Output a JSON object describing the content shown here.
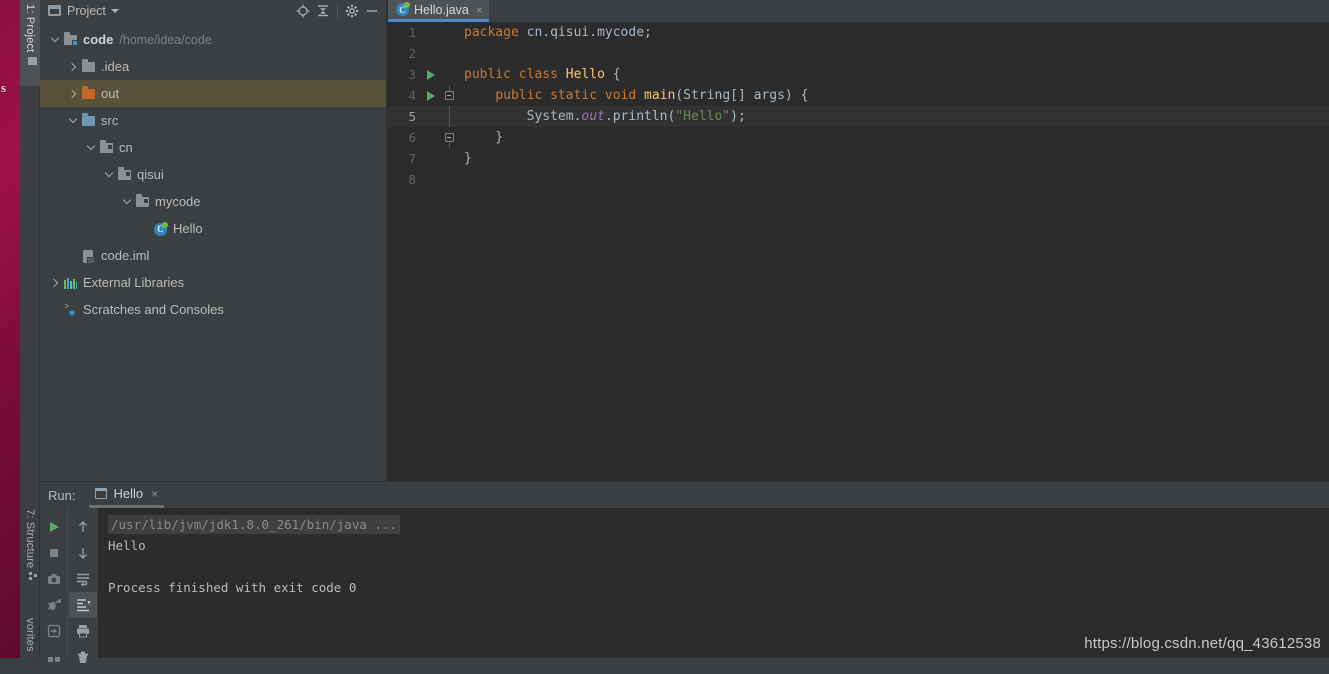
{
  "wallpaper": {
    "glyph": "s"
  },
  "left_stripe": {
    "tabs": [
      {
        "name": "project",
        "label": "1: Project",
        "icon": "folder-icon",
        "active": true
      },
      {
        "name": "structure",
        "label": "7: Structure",
        "icon": "structure-icon",
        "active": false
      },
      {
        "name": "favorites",
        "label": "vorites",
        "icon": "",
        "active": false
      }
    ]
  },
  "project_panel": {
    "title": "Project",
    "header_icons": [
      {
        "name": "locate-icon",
        "tooltip": "Select Opened File"
      },
      {
        "name": "collapse-all-icon",
        "tooltip": "Collapse All"
      },
      {
        "name": "gear-icon",
        "tooltip": "Settings"
      },
      {
        "name": "minimize-icon",
        "tooltip": "Hide"
      }
    ],
    "tree": [
      {
        "label": "code",
        "path": "/home/idea/code",
        "icon": "module-folder-icon",
        "arrow": "down",
        "indent": 0,
        "bold": true,
        "selected": false
      },
      {
        "label": ".idea",
        "path": "",
        "icon": "folder-gray-icon",
        "arrow": "right",
        "indent": 1,
        "bold": false,
        "selected": false
      },
      {
        "label": "out",
        "path": "",
        "icon": "folder-excluded-icon",
        "arrow": "right",
        "indent": 1,
        "bold": false,
        "selected": true
      },
      {
        "label": "src",
        "path": "",
        "icon": "folder-source-icon",
        "arrow": "down",
        "indent": 1,
        "bold": false,
        "selected": false
      },
      {
        "label": "cn",
        "path": "",
        "icon": "package-icon",
        "arrow": "down",
        "indent": 2,
        "bold": false,
        "selected": false
      },
      {
        "label": "qisui",
        "path": "",
        "icon": "package-icon",
        "arrow": "down",
        "indent": 3,
        "bold": false,
        "selected": false
      },
      {
        "label": "mycode",
        "path": "",
        "icon": "package-icon",
        "arrow": "down",
        "indent": 4,
        "bold": false,
        "selected": false
      },
      {
        "label": "Hello",
        "path": "",
        "icon": "java-class-icon",
        "arrow": "none",
        "indent": 5,
        "bold": false,
        "selected": false
      },
      {
        "label": "code.iml",
        "path": "",
        "icon": "iml-file-icon",
        "arrow": "none",
        "indent": 1,
        "bold": false,
        "selected": false
      },
      {
        "label": "External Libraries",
        "path": "",
        "icon": "libraries-icon",
        "arrow": "right",
        "indent": 0,
        "bold": false,
        "selected": false
      },
      {
        "label": "Scratches and Consoles",
        "path": "",
        "icon": "scratches-icon",
        "arrow": "none",
        "indent": 0,
        "bold": false,
        "selected": false
      }
    ]
  },
  "editor": {
    "tabs": [
      {
        "label": "Hello.java",
        "icon": "java-class-icon",
        "close": "×",
        "active": true
      }
    ],
    "current_line": 5,
    "lines": [
      {
        "n": "1",
        "run": false,
        "fold": "none",
        "tokens": [
          {
            "t": "package ",
            "c": "k"
          },
          {
            "t": "cn.qisui.mycode",
            "c": "p"
          },
          {
            "t": ";",
            "c": "sc"
          }
        ],
        "indent": 0
      },
      {
        "n": "2",
        "run": false,
        "fold": "none",
        "tokens": [],
        "indent": 0
      },
      {
        "n": "3",
        "run": true,
        "fold": "none",
        "tokens": [
          {
            "t": "public ",
            "c": "k"
          },
          {
            "t": "class ",
            "c": "k"
          },
          {
            "t": "Hello",
            "c": "m"
          },
          {
            "t": " {",
            "c": "p"
          }
        ],
        "indent": 0
      },
      {
        "n": "4",
        "run": true,
        "fold": "start",
        "tokens": [
          {
            "t": "    ",
            "c": "p"
          },
          {
            "t": "public ",
            "c": "k"
          },
          {
            "t": "static ",
            "c": "k"
          },
          {
            "t": "void ",
            "c": "k"
          },
          {
            "t": "main",
            "c": "m"
          },
          {
            "t": "(String[] args) {",
            "c": "p"
          }
        ],
        "indent": 1
      },
      {
        "n": "5",
        "run": false,
        "fold": "line",
        "tokens": [
          {
            "t": "        System.",
            "c": "p"
          },
          {
            "t": "out",
            "c": "f"
          },
          {
            "t": ".println(",
            "c": "p"
          },
          {
            "t": "\"Hello\"",
            "c": "s"
          },
          {
            "t": ");",
            "c": "sc"
          }
        ],
        "indent": 2
      },
      {
        "n": "6",
        "run": false,
        "fold": "end",
        "tokens": [
          {
            "t": "    }",
            "c": "p"
          }
        ],
        "indent": 1
      },
      {
        "n": "7",
        "run": false,
        "fold": "none",
        "tokens": [
          {
            "t": "}",
            "c": "p"
          }
        ],
        "indent": 0
      },
      {
        "n": "8",
        "run": false,
        "fold": "none",
        "tokens": [],
        "indent": 0
      }
    ]
  },
  "run_panel": {
    "label": "Run:",
    "tab_label": "Hello",
    "tab_close": "×",
    "toolbar_left": [
      {
        "name": "rerun-button",
        "icon": "play-icon",
        "active": false
      },
      {
        "name": "stop-button",
        "icon": "stop-icon",
        "active": false
      },
      {
        "name": "dump-threads-button",
        "icon": "camera-icon",
        "active": false
      },
      {
        "name": "restore-layout-button",
        "icon": "bug-arrow-icon",
        "active": false
      },
      {
        "name": "attach-button",
        "icon": "login-icon",
        "active": false
      },
      {
        "name": "layout-button",
        "icon": "layout-icon",
        "active": false
      }
    ],
    "toolbar_right": [
      {
        "name": "up-stack-button",
        "icon": "arrow-up-icon",
        "active": false
      },
      {
        "name": "down-stack-button",
        "icon": "arrow-down-icon",
        "active": false
      },
      {
        "name": "soft-wrap-button",
        "icon": "soft-wrap-icon",
        "active": false
      },
      {
        "name": "scroll-to-end-button",
        "icon": "scroll-end-icon",
        "active": true
      },
      {
        "name": "print-button",
        "icon": "printer-icon",
        "active": false
      },
      {
        "name": "clear-all-button",
        "icon": "trash-icon",
        "active": false
      }
    ],
    "console": [
      {
        "text": "/usr/lib/jvm/jdk1.8.0_261/bin/java ...",
        "type": "command"
      },
      {
        "text": "Hello",
        "type": "output"
      },
      {
        "text": "",
        "type": "output"
      },
      {
        "text": "Process finished with exit code 0",
        "type": "output"
      }
    ]
  },
  "watermark": "https://blog.csdn.net/qq_43612538",
  "colors": {
    "panel_bg": "#3c3f41",
    "editor_bg": "#2b2b2b",
    "selection": "#5a513a",
    "tab_underline": "#4a88c7",
    "keyword": "#cc7832",
    "method": "#ffc66d",
    "string": "#6a8759",
    "static_field": "#9876aa",
    "text": "#a9b7c6",
    "run_green": "#59a869"
  }
}
